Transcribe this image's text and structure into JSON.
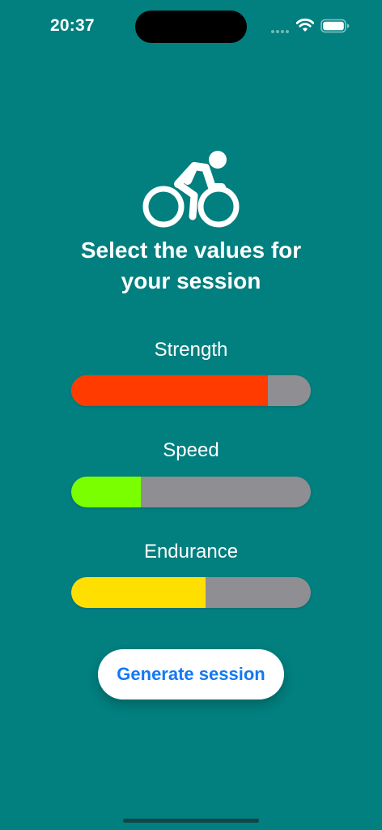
{
  "status_bar": {
    "time": "20:37"
  },
  "icons": {
    "hero": "bicycle-rider-icon",
    "wifi": "wifi-icon",
    "battery": "battery-icon",
    "signal": "cellular-signal-icon"
  },
  "heading": {
    "line1": "Select the values for",
    "line2": "your session"
  },
  "sliders": [
    {
      "label": "Strength",
      "value_fraction": 0.82,
      "color": "#ff3b00"
    },
    {
      "label": "Speed",
      "value_fraction": 0.29,
      "color": "#79ff00"
    },
    {
      "label": "Endurance",
      "value_fraction": 0.56,
      "color": "#ffdf00"
    }
  ],
  "generate_button": {
    "label": "Generate session"
  },
  "colors": {
    "background": "#027f7f",
    "track": "#8e8e93",
    "button_text": "#1279f4"
  }
}
